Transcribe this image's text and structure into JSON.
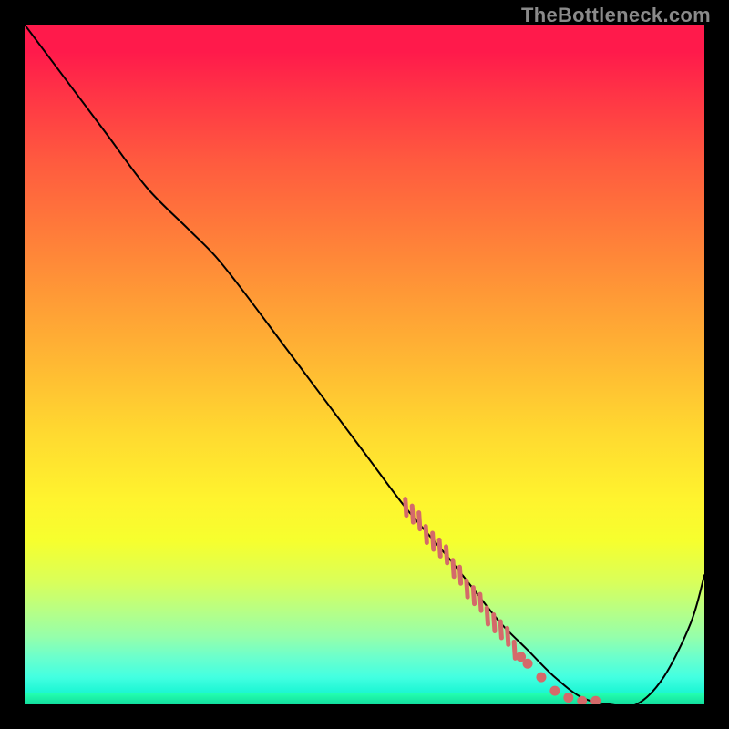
{
  "watermark": "TheBottleneck.com",
  "chart_data": {
    "type": "line",
    "title": "",
    "xlabel": "",
    "ylabel": "",
    "xlim": [
      0,
      100
    ],
    "ylim": [
      0,
      100
    ],
    "grid": false,
    "series": [
      {
        "name": "bottleneck-curve",
        "x": [
          0,
          6,
          12,
          18,
          24,
          28,
          32,
          38,
          44,
          50,
          56,
          62,
          66,
          70,
          74,
          78,
          82,
          86,
          90,
          94,
          98,
          100
        ],
        "y": [
          100,
          92,
          84,
          76,
          70,
          66,
          61,
          53,
          45,
          37,
          29,
          22,
          17,
          12,
          8,
          4,
          1,
          0,
          0,
          4,
          12,
          19
        ],
        "color": "#000000",
        "stroke_width": 2
      }
    ],
    "markers": {
      "name": "highlight-cluster",
      "color": "#d46a6a",
      "points": [
        {
          "x": 56,
          "y": 29,
          "shape": "tick"
        },
        {
          "x": 57,
          "y": 28,
          "shape": "tick"
        },
        {
          "x": 58,
          "y": 27,
          "shape": "tick"
        },
        {
          "x": 59,
          "y": 25,
          "shape": "tick"
        },
        {
          "x": 60,
          "y": 24,
          "shape": "tick"
        },
        {
          "x": 61,
          "y": 23,
          "shape": "tick"
        },
        {
          "x": 62,
          "y": 22,
          "shape": "tick"
        },
        {
          "x": 63,
          "y": 20,
          "shape": "tick"
        },
        {
          "x": 64,
          "y": 19,
          "shape": "tick"
        },
        {
          "x": 65,
          "y": 17,
          "shape": "tick"
        },
        {
          "x": 66,
          "y": 16,
          "shape": "tick"
        },
        {
          "x": 67,
          "y": 15,
          "shape": "tick"
        },
        {
          "x": 68,
          "y": 13,
          "shape": "tick"
        },
        {
          "x": 69,
          "y": 12,
          "shape": "tick"
        },
        {
          "x": 70,
          "y": 11,
          "shape": "tick"
        },
        {
          "x": 71,
          "y": 10,
          "shape": "tick"
        },
        {
          "x": 72,
          "y": 8,
          "shape": "tick"
        },
        {
          "x": 73,
          "y": 7,
          "shape": "dot"
        },
        {
          "x": 74,
          "y": 6,
          "shape": "dot"
        },
        {
          "x": 76,
          "y": 4,
          "shape": "dot"
        },
        {
          "x": 78,
          "y": 2,
          "shape": "dot"
        },
        {
          "x": 80,
          "y": 1,
          "shape": "dot"
        },
        {
          "x": 82,
          "y": 0.5,
          "shape": "dot"
        },
        {
          "x": 84,
          "y": 0.5,
          "shape": "dot"
        }
      ]
    }
  }
}
